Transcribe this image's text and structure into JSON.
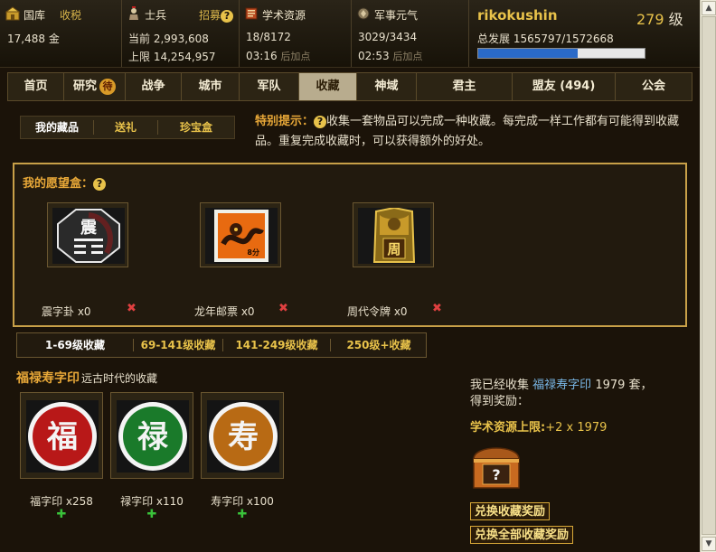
{
  "resources": {
    "treasury": {
      "title": "国库",
      "link": "收税",
      "amount": "17,488",
      "unit": "金"
    },
    "soldiers": {
      "title": "士兵",
      "link": "招募",
      "current_label": "当前",
      "current": "2,993,608",
      "limit_label": "上限",
      "limit": "14,254,957"
    },
    "academic": {
      "title": "学术资源",
      "ratio": "18/8172",
      "timer": "03:16",
      "timer_suffix": "后加点"
    },
    "military": {
      "title": "军事元气",
      "ratio": "3029/3434",
      "timer": "02:53",
      "timer_suffix": "后加点"
    }
  },
  "player": {
    "name": "rikokushin",
    "level": "279",
    "level_unit": "级",
    "progress_label": "总发展",
    "progress": "1565797/1572668",
    "progress_fraction": 0.6
  },
  "nav": {
    "tabs": [
      "首页",
      "研究",
      "战争",
      "城市",
      "军队",
      "收藏",
      "神域",
      "君主",
      "盟友 (494)",
      "公会"
    ],
    "research_badge": "待",
    "active": "收藏"
  },
  "subtabs": [
    "我的藏品",
    "送礼",
    "珍宝盒"
  ],
  "tip": {
    "label": "特别提示：",
    "text": "收集一套物品可以完成一种收藏。每完成一样工作都有可能得到收藏品。重复完成收藏时，可以获得额外的好处。"
  },
  "wishbox": {
    "title": "我的愿望盒：",
    "items": [
      {
        "label": "震字卦 x0",
        "icon": "zhen-trigram-icon",
        "glyph": "震"
      },
      {
        "label": "龙年邮票 x0",
        "icon": "dragon-stamp-icon",
        "value_text": "8分"
      },
      {
        "label": "周代令牌 x0",
        "icon": "zhou-token-icon",
        "glyph": "周"
      }
    ],
    "remove_symbol": "✖"
  },
  "level_tabs": [
    "1-69级收藏",
    "69-141级收藏",
    "141-249级收藏",
    "250级+收藏"
  ],
  "collection": {
    "name": "福禄寿字印",
    "description": "远古时代的收藏",
    "items": [
      {
        "label": "福字印 x258",
        "glyph": "福",
        "color": "#b81818"
      },
      {
        "label": "禄字印 x110",
        "glyph": "禄",
        "color": "#1a7a2a"
      },
      {
        "label": "寿字印 x100",
        "glyph": "寿",
        "color": "#b86a14"
      }
    ],
    "add_symbol": "✚"
  },
  "reward": {
    "prefix": "我已经收集",
    "name": "福禄寿字印",
    "count": "1979",
    "suffix": "套，",
    "line2": "得到奖励：",
    "bonus_label": "学术资源上限:",
    "bonus_value": "+2 x 1979",
    "chest_mark": "?",
    "buttons": [
      "兑换收藏奖励",
      "兑换全部收藏奖励"
    ]
  },
  "colors": {
    "gold": "#e8c24a",
    "orange": "#e8a838",
    "link_blue": "#7ab8e8",
    "remove_red": "#e04040",
    "add_green": "#3ac23a"
  }
}
